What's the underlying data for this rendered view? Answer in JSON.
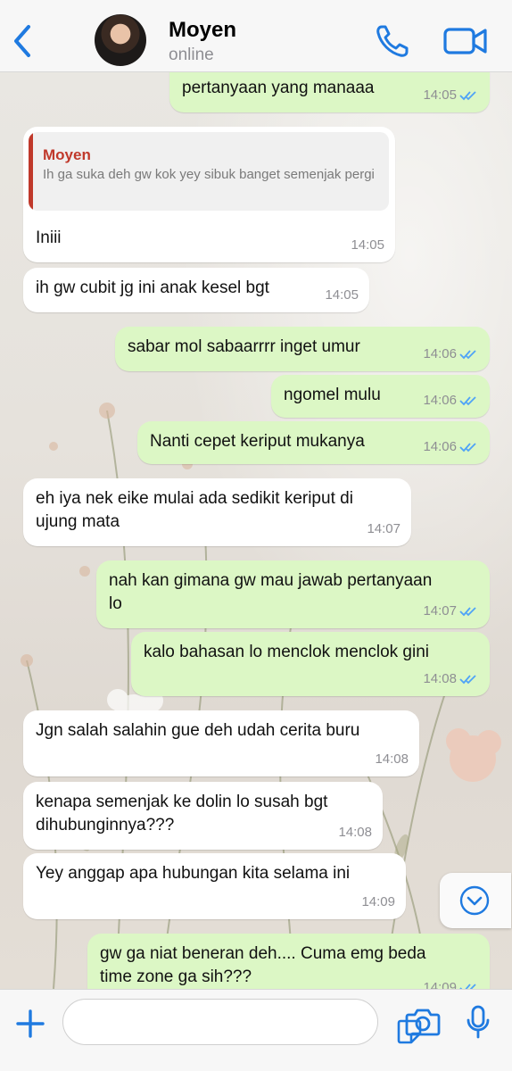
{
  "header": {
    "back_icon": "chevron-left-icon",
    "contact_name": "Moyen",
    "contact_status": "online",
    "call_icon": "phone-icon",
    "video_icon": "video-camera-icon",
    "accent_color": "#1f7ae0"
  },
  "messages": [
    {
      "dir": "out",
      "text": "pertanyaan yang manaaa",
      "time": "14:05",
      "read": true
    },
    {
      "dir": "in",
      "quote_name": "Moyen",
      "quote_text": "Ih ga suka deh gw kok yey sibuk banget semenjak pergi",
      "text": "Iniii",
      "time": "14:05"
    },
    {
      "dir": "in",
      "text": "ih gw cubit jg ini anak kesel bgt",
      "time": "14:05"
    },
    {
      "dir": "out",
      "text": "sabar mol sabaarrrr inget umur",
      "time": "14:06",
      "read": true
    },
    {
      "dir": "out",
      "text": "ngomel mulu",
      "time": "14:06",
      "read": true
    },
    {
      "dir": "out",
      "text": "Nanti cepet keriput mukanya",
      "time": "14:06",
      "read": true
    },
    {
      "dir": "in",
      "text": "eh iya nek eike mulai ada sedikit keriput di\nujung mata",
      "time": "14:07"
    },
    {
      "dir": "out",
      "text": "nah kan gimana gw mau jawab pertanyaan\nlo",
      "time": "14:07",
      "read": true
    },
    {
      "dir": "out",
      "text": "kalo bahasan lo menclok menclok gini",
      "time": "14:08",
      "read": true
    },
    {
      "dir": "in",
      "text": "Jgn salah salahin gue deh udah cerita buru",
      "time": "14:08"
    },
    {
      "dir": "in",
      "text": "kenapa semenjak ke dolin lo susah bgt\ndihubunginnya???",
      "time": "14:08"
    },
    {
      "dir": "in",
      "text": "Yey anggap apa hubungan kita selama ini",
      "time": "14:09"
    },
    {
      "dir": "out",
      "text": "gw ga niat beneran deh.... Cuma emg beda\ntime zone ga sih???",
      "time": "14:09",
      "read": true
    }
  ],
  "scroll_down_icon": "chevron-down-circle-icon",
  "input_bar": {
    "plus_icon": "plus-icon",
    "message_placeholder": "",
    "sticker_icon": "sticker-icon",
    "camera_icon": "camera-icon",
    "mic_icon": "microphone-icon"
  },
  "colors": {
    "outgoing_bubble": "#dcf7c5",
    "incoming_bubble": "#ffffff",
    "read_ticks": "#4fa3f7",
    "quote_accent": "#c0392b"
  }
}
